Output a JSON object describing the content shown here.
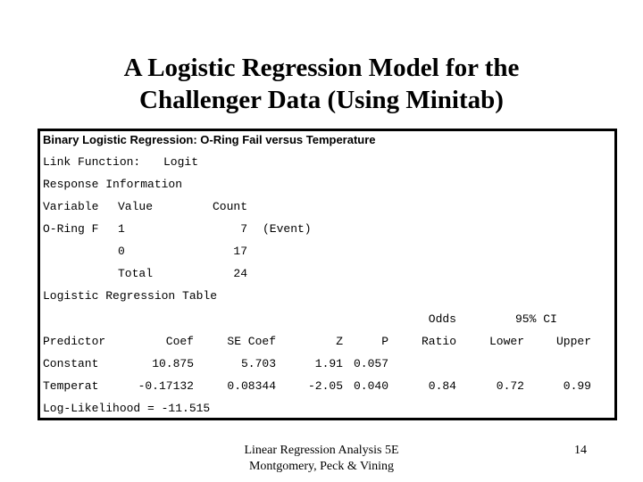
{
  "slide": {
    "title_line1": "A Logistic Regression Model for the",
    "title_line2": "Challenger Data (Using Minitab)",
    "footer_line1": "Linear Regression Analysis 5E",
    "footer_line2": "Montgomery, Peck & Vining",
    "page_number": "14"
  },
  "output": {
    "header": "Binary Logistic Regression: O-Ring Fail versus Temperature",
    "link_function_label": "Link Function:",
    "link_function_value": "Logit",
    "response_info_title": "Response Information",
    "response_columns": [
      "Variable",
      "Value",
      "Count"
    ],
    "response_rows": [
      {
        "variable": "O-Ring F",
        "value": "1",
        "count": "7",
        "note": "(Event)"
      },
      {
        "variable": "",
        "value": "0",
        "count": "17",
        "note": ""
      },
      {
        "variable": "",
        "value": "Total",
        "count": "24",
        "note": ""
      }
    ],
    "regression_table_title": "Logistic Regression Table",
    "group_headers": {
      "odds": "Odds",
      "ci": "95% CI"
    },
    "columns": [
      "Predictor",
      "Coef",
      "SE Coef",
      "Z",
      "P",
      "Ratio",
      "Lower",
      "Upper"
    ],
    "rows": [
      {
        "predictor": "Constant",
        "coef": "10.875",
        "se_coef": "5.703",
        "z": "1.91",
        "p": "0.057",
        "ratio": "",
        "lower": "",
        "upper": ""
      },
      {
        "predictor": "Temperat",
        "coef": "-0.17132",
        "se_coef": "0.08344",
        "z": "-2.05",
        "p": "0.040",
        "ratio": "0.84",
        "lower": "0.72",
        "upper": "0.99"
      }
    ],
    "log_likelihood": "Log-Likelihood = -11.515"
  }
}
